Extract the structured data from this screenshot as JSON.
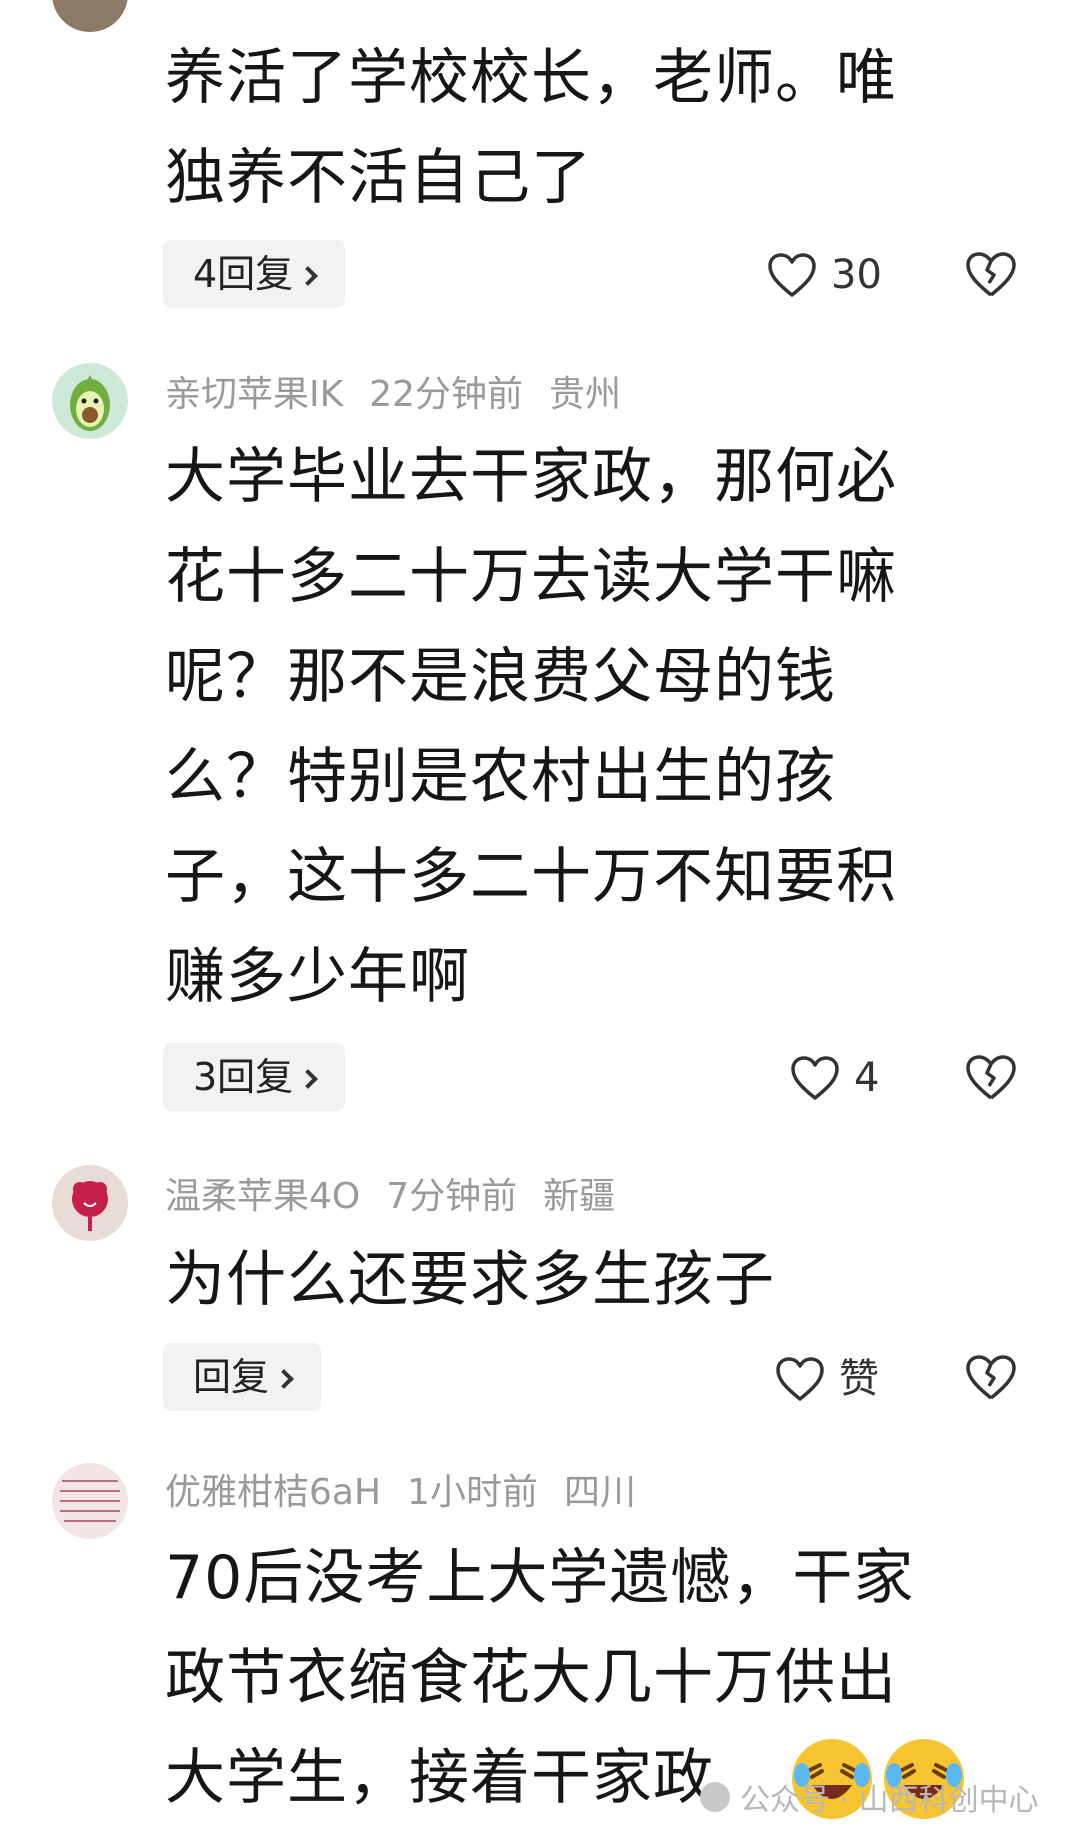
{
  "comments": [
    {
      "body_lines": [
        "养活了学校校长，老师。唯",
        "独养不活自己了"
      ],
      "replies_label": "4回复",
      "likes": "30"
    },
    {
      "username": "亲切苹果IK",
      "time": "22分钟前",
      "location": "贵州",
      "body_lines": [
        "大学毕业去干家政，那何必",
        "花十多二十万去读大学干嘛",
        "呢？那不是浪费父母的钱",
        "么？特别是农村出生的孩",
        "子，这十多二十万不知要积",
        "赚多少年啊"
      ],
      "replies_label": "3回复",
      "likes": "4"
    },
    {
      "username": "温柔苹果4O",
      "time": "7分钟前",
      "location": "新疆",
      "body_lines": [
        "为什么还要求多生孩子"
      ],
      "replies_label": "回复",
      "likes": "赞"
    },
    {
      "username": "优雅柑桔6aH",
      "time": "1小时前",
      "location": "四川",
      "body_lines": [
        "70后没考上大学遗憾，干家",
        "政节衣缩食花大几十万供出",
        "大学生，接着干家政"
      ]
    }
  ],
  "watermark": "公众号 · 山西科创中心",
  "icons": {
    "like": "heart-outline-icon",
    "dislike": "broken-heart-icon",
    "emoji": "laughing-crying-emoji"
  },
  "colors": {
    "meta_text": "#9a9a9a",
    "reply_bg": "#f2f2f2",
    "body_text": "#161616"
  }
}
